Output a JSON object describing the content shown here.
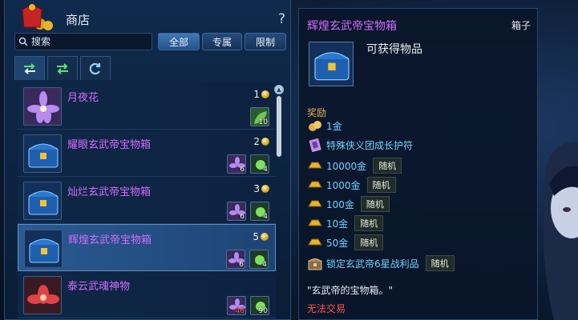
{
  "shop": {
    "title": "商店",
    "help": "?",
    "search_placeholder": "搜索",
    "filters": [
      "全部",
      "专属",
      "限制"
    ],
    "active_filter": "全部",
    "tab_icons": [
      "swap-arrows-icon",
      "swap-arrows-green-icon",
      "refresh-icon"
    ],
    "items": [
      {
        "name": "月夜花",
        "price": "1",
        "mats": [
          {
            "icon": "green-leaf-icon",
            "qty": "10"
          }
        ]
      },
      {
        "name": "耀眼玄武帝宝物箱",
        "price": "2",
        "mats": [
          {
            "icon": "purple-flower-icon",
            "qty": "6"
          },
          {
            "icon": "green-orb-icon",
            "qty": "4"
          }
        ]
      },
      {
        "name": "灿烂玄武帝宝物箱",
        "price": "3",
        "mats": [
          {
            "icon": "purple-flower-icon",
            "qty": "6"
          },
          {
            "icon": "green-orb-icon",
            "qty": "4"
          }
        ]
      },
      {
        "name": "辉煌玄武帝宝物箱",
        "price": "5",
        "selected": true,
        "mats": [
          {
            "icon": "purple-flower-icon",
            "qty": "6"
          },
          {
            "icon": "green-orb-icon",
            "qty": "4"
          }
        ]
      },
      {
        "name": "泰云武魂神物",
        "price": "",
        "mats": [
          {
            "icon": "purple-flower-icon",
            "qty": "46"
          },
          {
            "icon": "green-orb-icon",
            "qty": "90"
          }
        ]
      }
    ]
  },
  "detail": {
    "title": "辉煌玄武帝宝物箱",
    "type": "箱子",
    "obtain_label": "可获得物品",
    "reward_label": "奖励",
    "rewards": [
      {
        "text": "1金",
        "tag": ""
      },
      {
        "text": "特殊侠义团成长护符",
        "tag": ""
      },
      {
        "text": "10000金",
        "tag": "随机"
      },
      {
        "text": "1000金",
        "tag": "随机"
      },
      {
        "text": "100金",
        "tag": "随机"
      },
      {
        "text": "10金",
        "tag": "随机"
      },
      {
        "text": "50金",
        "tag": "随机"
      },
      {
        "text": "锁定玄武帝6星战利品",
        "tag": "随机"
      }
    ],
    "quote": "\"玄武帝的宝物箱。\"",
    "untradeable": "无法交易"
  },
  "colors": {
    "item_name": "#d26bff",
    "reward_text": "#6fd2ff",
    "warning": "#ff5050",
    "reward_label": "#e0b04c"
  }
}
